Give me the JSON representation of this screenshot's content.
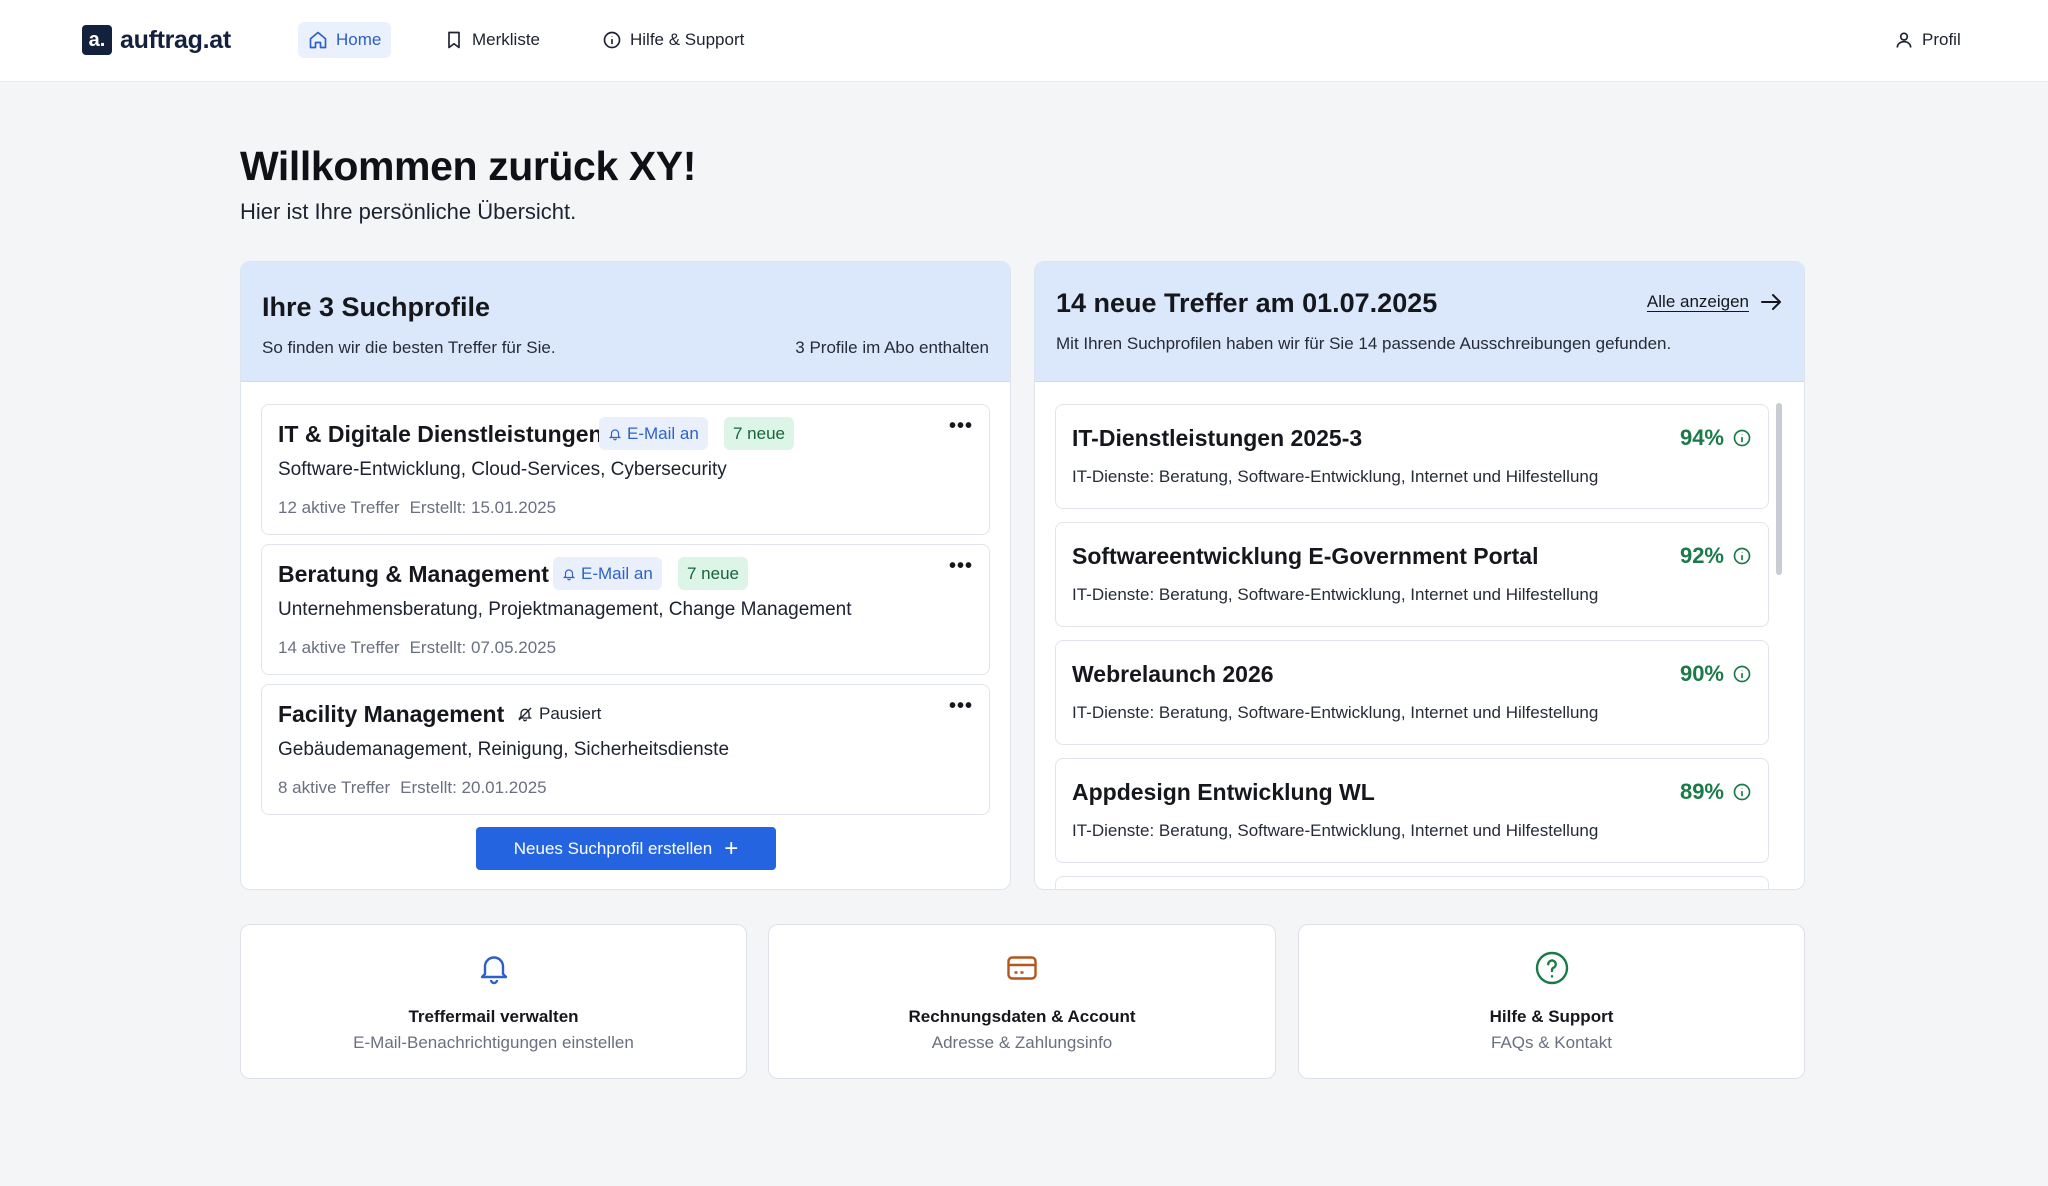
{
  "nav": {
    "logo_mark": "a.",
    "logo_text": "auftrag.at",
    "home": "Home",
    "merkliste": "Merkliste",
    "help": "Hilfe & Support",
    "profile": "Profil"
  },
  "header": {
    "title": "Willkommen zurück XY!",
    "subtitle": "Hier ist Ihre persönliche Übersicht."
  },
  "profiles_panel": {
    "title": "Ihre 3 Suchprofile",
    "subtitle": "So finden wir die besten Treffer für Sie.",
    "abo_info": "3 Profile im Abo enthalten",
    "button_label": "Neues Suchprofil erstellen",
    "items": [
      {
        "title": "IT & Digitale Dienstleistungen",
        "mail_badge": "E-Mail an",
        "new_badge": "7 neue",
        "tags": "Software-Entwicklung, Cloud-Services, Cybersecurity",
        "hits": "12 aktive Treffer",
        "created": "Erstellt: 15.01.2025"
      },
      {
        "title": "Beratung & Management",
        "mail_badge": "E-Mail an",
        "new_badge": "7 neue",
        "tags": "Unternehmensberatung, Projektmanagement, Change Management",
        "hits": "14 aktive Treffer",
        "created": "Erstellt: 07.05.2025"
      },
      {
        "title": "Facility Management",
        "status_badge": "Pausiert",
        "tags": "Gebäudemanagement, Reinigung, Sicherheitsdienste",
        "hits": "8 aktive Treffer",
        "created": "Erstellt: 20.01.2025"
      }
    ]
  },
  "matches_panel": {
    "title": "14 neue Treffer am 01.07.2025",
    "subtitle": "Mit Ihren Suchprofilen haben wir für Sie 14 passende Ausschreibungen gefunden.",
    "all_link": "Alle anzeigen",
    "items": [
      {
        "title": "IT-Dienstleistungen 2025-3",
        "score": "94%",
        "desc": "IT-Dienste: Beratung, Software-Entwicklung, Internet und Hilfestellung"
      },
      {
        "title": "Softwareentwicklung E-Government Portal",
        "score": "92%",
        "desc": "IT-Dienste: Beratung, Software-Entwicklung, Internet und Hilfestellung"
      },
      {
        "title": "Webrelaunch 2026",
        "score": "90%",
        "desc": "IT-Dienste: Beratung, Software-Entwicklung, Internet und Hilfestellung"
      },
      {
        "title": "Appdesign Entwicklung WL",
        "score": "89%",
        "desc": "IT-Dienste: Beratung, Software-Entwicklung, Internet und Hilfestellung"
      }
    ]
  },
  "quick_links": [
    {
      "title": "Treffermail verwalten",
      "subtitle": "E-Mail-Benachrichtigungen einstellen",
      "icon": "bell-icon",
      "color": "#2c5fc9"
    },
    {
      "title": "Rechnungsdaten & Account",
      "subtitle": "Adresse & Zahlungsinfo",
      "icon": "credit-card-icon",
      "color": "#b5541d"
    },
    {
      "title": "Hilfe & Support",
      "subtitle": "FAQs & Kontakt",
      "icon": "help-circle-icon",
      "color": "#1a7a48"
    }
  ],
  "colors": {
    "accent": "#2564e0",
    "panel_header": "#dbe8fb",
    "score_green": "#1a7a48"
  }
}
